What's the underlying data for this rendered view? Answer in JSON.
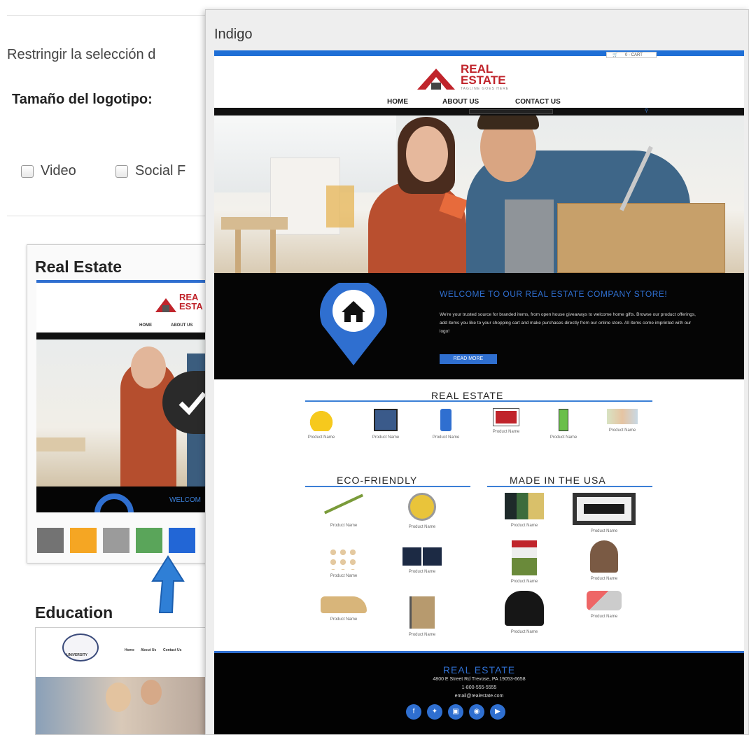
{
  "background": {
    "restrict_label": "Restringir la selección d",
    "logo_size_label": "Tamaño del logotipo:",
    "checkboxes": [
      {
        "label": "Video"
      },
      {
        "label": "Social F"
      }
    ]
  },
  "templates": [
    {
      "title": "Real Estate",
      "mini_nav": [
        "HOME",
        "ABOUT US"
      ],
      "mini_logo": "REA ESTA",
      "mini_welcome": "WELCOM",
      "swatches": [
        "#737373",
        "#f5a623",
        "#9b9b9b",
        "#5aa55a",
        "#2266d6"
      ]
    },
    {
      "title": "Education",
      "mini_nav": [
        "Home",
        "About Us",
        "Contact Us"
      ],
      "mini_logo": "UNIVERSITY"
    }
  ],
  "popup": {
    "title": "Indigo",
    "site": {
      "cart": "0 - CART",
      "logo_line1": "REAL",
      "logo_line2": "ESTATE",
      "tagline": "TAGLINE GOES HERE",
      "nav": [
        "HOME",
        "ABOUT US",
        "CONTACT US"
      ],
      "welcome_title": "WELCOME TO OUR REAL ESTATE COMPANY STORE!",
      "welcome_body": "We're your trusted source for branded items, from open house giveaways to welcome home gifts. Browse our product offerings, add items you like to your shopping cart and make purchases directly from our online store. All items come imprinted with our logo!",
      "read_more": "READ MORE",
      "section_real_estate": "REAL ESTATE",
      "section_eco": "ECO-FRIENDLY",
      "section_usa": "MADE IN THE USA",
      "product_label": "Product Name",
      "footer_title": "REAL ESTATE",
      "footer_address": "4800 E Street Rd Trevose, PA 19053-6658",
      "footer_phone": "1-800-555-5555",
      "footer_email": "email@realestate.com"
    }
  },
  "colors": {
    "accent": "#2f6fd0",
    "brand_red": "#c0242b",
    "arrow": "#2f7fd6"
  }
}
